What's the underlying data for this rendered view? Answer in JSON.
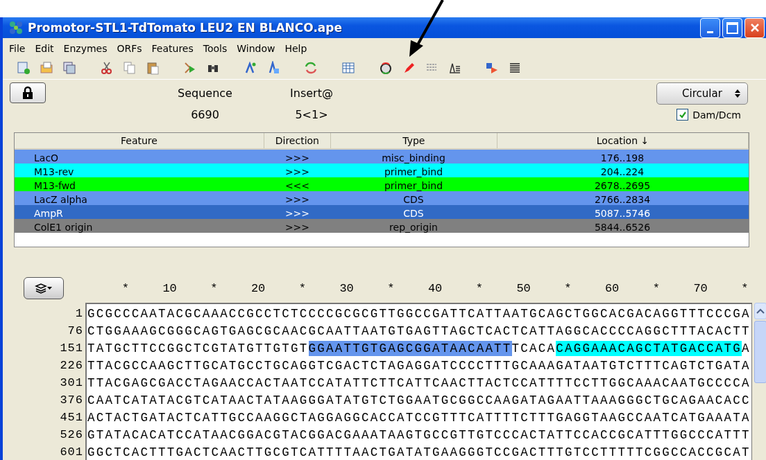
{
  "window": {
    "title": "Promotor-STL1-TdTomato LEU2 EN BLANCO.ape"
  },
  "menu": [
    "File",
    "Edit",
    "Enzymes",
    "ORFs",
    "Features",
    "Tools",
    "Window",
    "Help"
  ],
  "info": {
    "sequence_label": "Sequence",
    "sequence_value": "6690",
    "insert_label": "Insert@",
    "insert_value": "5<1>",
    "locked": true,
    "topology": "Circular",
    "dam_dcm": {
      "label": "Dam/Dcm",
      "checked": true
    }
  },
  "feature_table": {
    "columns": [
      "Feature",
      "Direction",
      "Type",
      "Location ↓"
    ],
    "rows": [
      {
        "feature": "LacO",
        "direction": ">>>",
        "type": "misc_binding",
        "location": "176..198",
        "color": "#6495ed"
      },
      {
        "feature": "M13-rev",
        "direction": ">>>",
        "type": "primer_bind",
        "location": "204..224",
        "color": "#00ffff"
      },
      {
        "feature": "M13-fwd",
        "direction": "<<<",
        "type": "primer_bind",
        "location": "2678..2695",
        "color": "#00ff00"
      },
      {
        "feature": "LacZ alpha",
        "direction": ">>>",
        "type": "CDS",
        "location": "2766..2834",
        "color": "#6495ed"
      },
      {
        "feature": "AmpR",
        "direction": ">>>",
        "type": "CDS",
        "location": "5087..5746",
        "color": "#316ac5"
      },
      {
        "feature": "ColE1 origin",
        "direction": ">>>",
        "type": "rep_origin",
        "location": "5844..6526",
        "color": "#808080"
      }
    ]
  },
  "ruler": [
    "*",
    "10",
    "*",
    "20",
    "*",
    "30",
    "*",
    "40",
    "*",
    "50",
    "*",
    "60",
    "*",
    "70",
    "*"
  ],
  "sequence": [
    {
      "number": "1",
      "segments": [
        {
          "text": "GCGCCCAATACGCAAACCGCCTCTCCCCGCGCGTTGGCCGATTCATTAATGCAGCTGGCACGACAGGTTTCCCGA"
        }
      ]
    },
    {
      "number": "76",
      "segments": [
        {
          "text": "CTGGAAAGCGGGCAGTGAGCGCAACGCAATTAATGTGAGTTAGCTCACTCATTAGGCACCCCAGGCTTTACACTT"
        }
      ]
    },
    {
      "number": "151",
      "segments": [
        {
          "text": "TATGCTTCCGGCTCGTATGTTGTGT"
        },
        {
          "text": "GGAATTGTGAGCGGATAACAATT",
          "color": "#6495ed"
        },
        {
          "text": "TCACA"
        },
        {
          "text": "CAGGAAACAGCTATGACCATG",
          "color": "#00ffff"
        },
        {
          "text": "A"
        }
      ]
    },
    {
      "number": "226",
      "segments": [
        {
          "text": "TTACGCCAAGCTTGCATGCCTGCAGGTCGACTCTAGAGGATCCCCTTTGCAAAGATAATGTCTTTCAGTCTGATA"
        }
      ]
    },
    {
      "number": "301",
      "segments": [
        {
          "text": "TTACGAGCGACCTAGAACCACTAATCCATATTCTTCATTCAACTTACTCCATTTTCCTTGGCAAACAATGCCCCA"
        }
      ]
    },
    {
      "number": "376",
      "segments": [
        {
          "text": "CAATCATATACGTCATAACTATAAGGGATATGTCTGGAATGCGGCCAAGATAGAATTAAAGGGCTGCAGAACACC"
        }
      ]
    },
    {
      "number": "451",
      "segments": [
        {
          "text": "ACTACTGATACTCATTGCCAAGGCTAGGAGGCACCATCCGTTTCATTTTCTTTGAGGTAAGCCAATCATGAAATA"
        }
      ]
    },
    {
      "number": "526",
      "segments": [
        {
          "text": "GTATACACATCCATAACGGACGTACGGACGAAATAAGTGCCGTTGTCCCACTATTCCACCGCATTTGGCCCATTT"
        }
      ]
    },
    {
      "number": "601",
      "segments": [
        {
          "text": "GGCTCACTTTGACTCAACTTGCGTCATTTTAACTGATATGAAGGGTCCGACTTTGTCCTTTTTCGGCCACCGCAT"
        }
      ]
    }
  ]
}
